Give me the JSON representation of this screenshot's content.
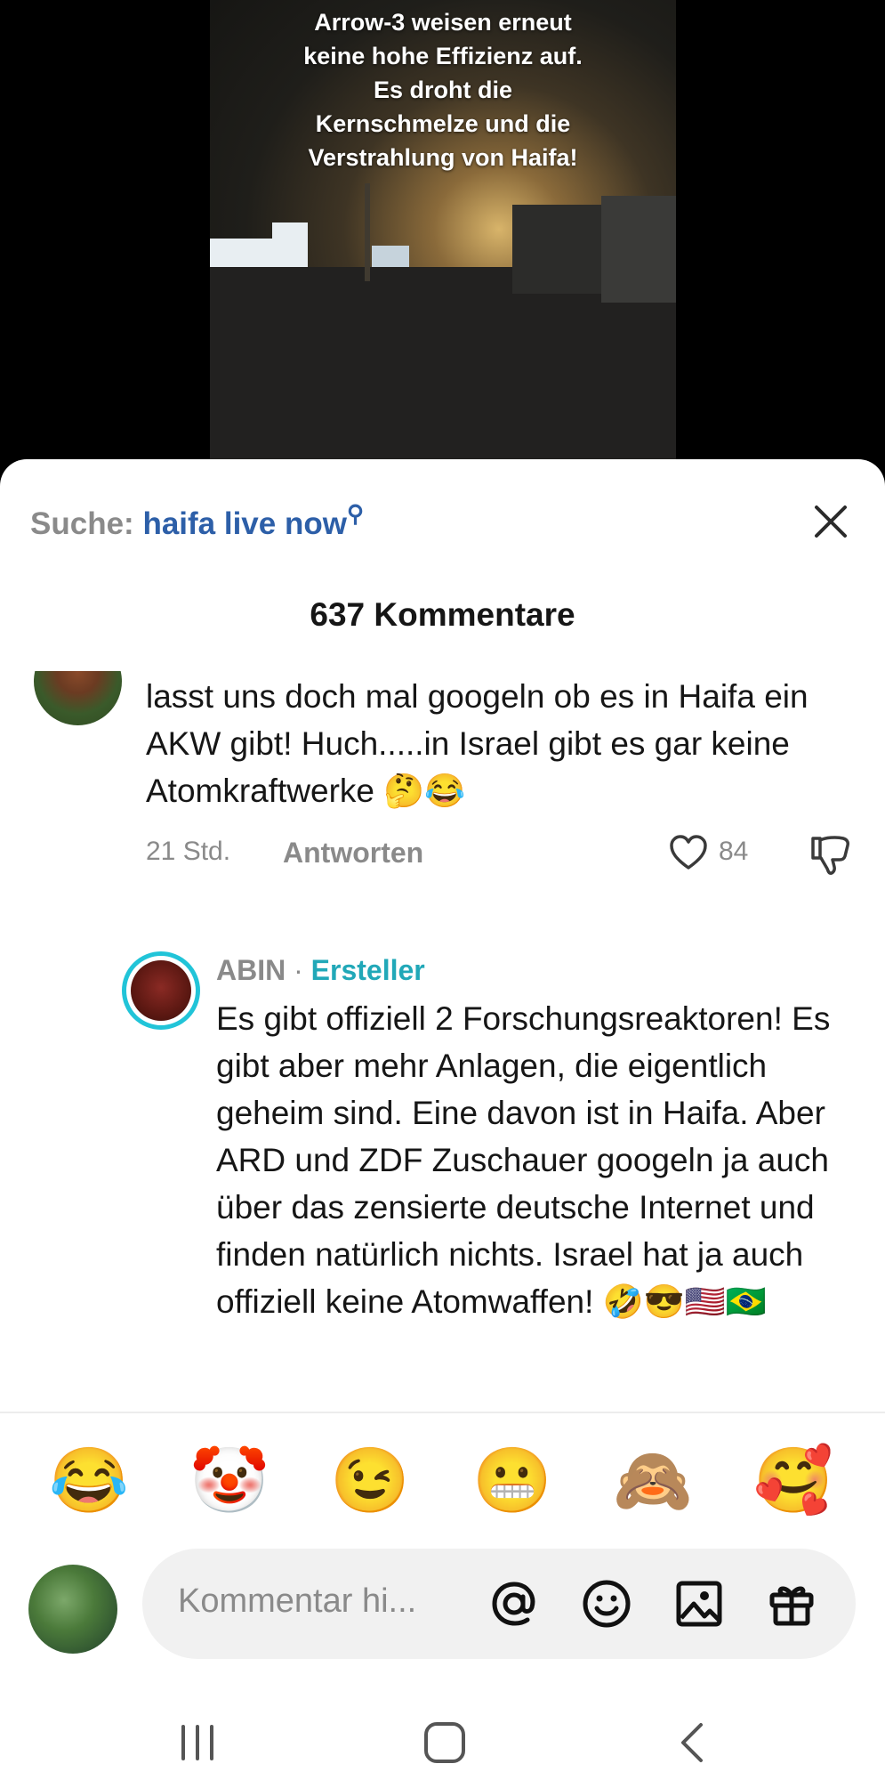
{
  "video": {
    "caption_lines": [
      "Arrow-3 weisen erneut",
      "keine hohe Effizienz auf.",
      "Es droht die",
      "Kernschmelze und die",
      "Verstrahlung von Haifa!"
    ]
  },
  "sheet": {
    "search_prefix": "Suche:",
    "search_query": "haifa live now",
    "comment_count": "637 Kommentare"
  },
  "comment1": {
    "text": "lasst uns doch mal googeln ob es in Haifa ein AKW gibt! Huch.....in Israel gibt es gar keine Atomkraftwerke 🤔😂",
    "time": "21 Std.",
    "reply_label": "Antworten",
    "likes": "84"
  },
  "comment2": {
    "user": "ABIN",
    "separator": "·",
    "badge": "Ersteller",
    "text": "Es gibt offiziell 2 Forschungsreaktoren! Es gibt aber mehr Anlagen, die eigentlich geheim sind. Eine davon ist in Haifa. Aber ARD und ZDF Zuschauer googeln ja auch über das zensierte deutsche Internet und finden natürlich nichts. Israel hat ja auch offiziell keine Atomwaffen! 🤣😎🇺🇸🇧🇷"
  },
  "quick_emojis": [
    "😂",
    "🤡",
    "😉",
    "😬",
    "🙈",
    "🥰"
  ],
  "input": {
    "placeholder": "Kommentar hi..."
  },
  "icons": {
    "close": "close-icon",
    "like": "heart-icon",
    "dislike": "thumbs-down-icon",
    "mention": "at-icon",
    "emoji": "smiley-icon",
    "image": "image-icon",
    "gift": "gift-icon",
    "nav_recent": "recent-apps-icon",
    "nav_home": "home-icon",
    "nav_back": "back-icon"
  },
  "colors": {
    "accent_link": "#2d5fa8",
    "creator_badge": "#21a8b8",
    "avatar_ring": "#21c4d8",
    "muted_text": "#8a8a8a"
  }
}
